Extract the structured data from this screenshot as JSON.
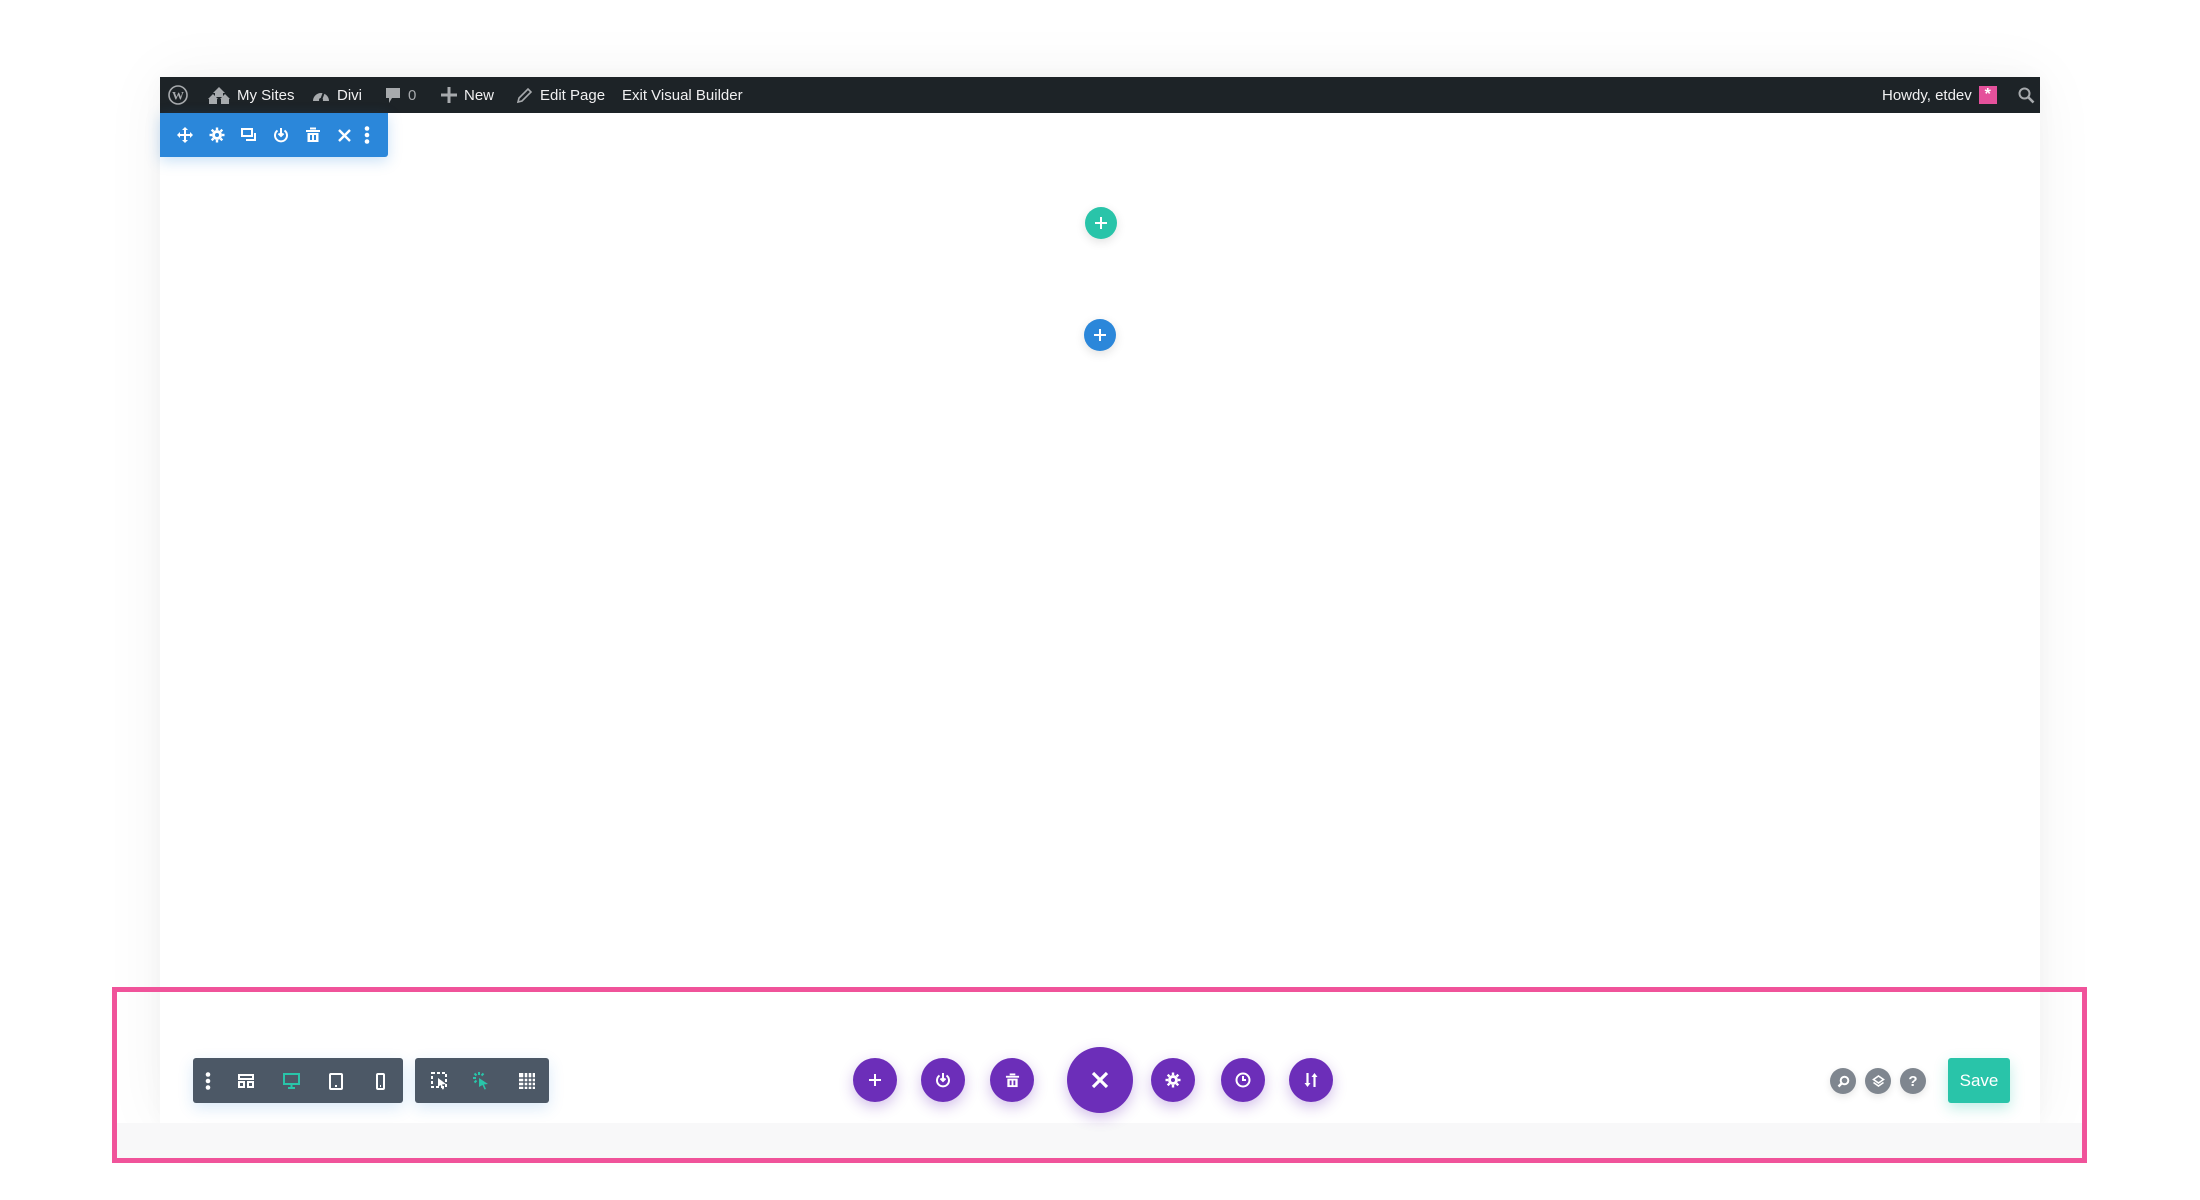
{
  "admin_bar": {
    "wp_logo_icon": "wordpress-icon",
    "my_sites": "My Sites",
    "site_name": "Divi",
    "comments_count": "0",
    "new_label": "New",
    "edit_page": "Edit Page",
    "exit_builder": "Exit Visual Builder",
    "greeting": "Howdy, etdev",
    "avatar_glyph": "*"
  },
  "section_toolbar": {
    "icons": [
      "move-icon",
      "gear-icon",
      "duplicate-icon",
      "save-to-library-icon",
      "trash-icon",
      "close-icon",
      "more-icon"
    ],
    "color": "#2b87da"
  },
  "canvas": {
    "add_row_color": "#29c4a9",
    "add_section_color": "#2b87da"
  },
  "bottom_bar": {
    "left_group": [
      "more-icon",
      "wireframe-view-icon",
      "desktop-view-icon",
      "tablet-view-icon",
      "phone-view-icon"
    ],
    "left_group_active": "desktop-view-icon",
    "mode_group": [
      "click-mode-icon",
      "hover-mode-icon",
      "grid-mode-icon"
    ],
    "mode_group_active": "hover-mode-icon",
    "center_actions": [
      "add-from-library-icon",
      "save-to-library-icon",
      "clear-layout-icon",
      "close-icon",
      "page-settings-icon",
      "history-icon",
      "portability-icon"
    ],
    "right_icons": [
      "search-icon",
      "layers-icon",
      "help-icon"
    ],
    "help_glyph": "?",
    "save_label": "Save",
    "accent_purple": "#6c2eb9",
    "accent_teal": "#29c4a9"
  },
  "highlight_color": "#f0539a"
}
